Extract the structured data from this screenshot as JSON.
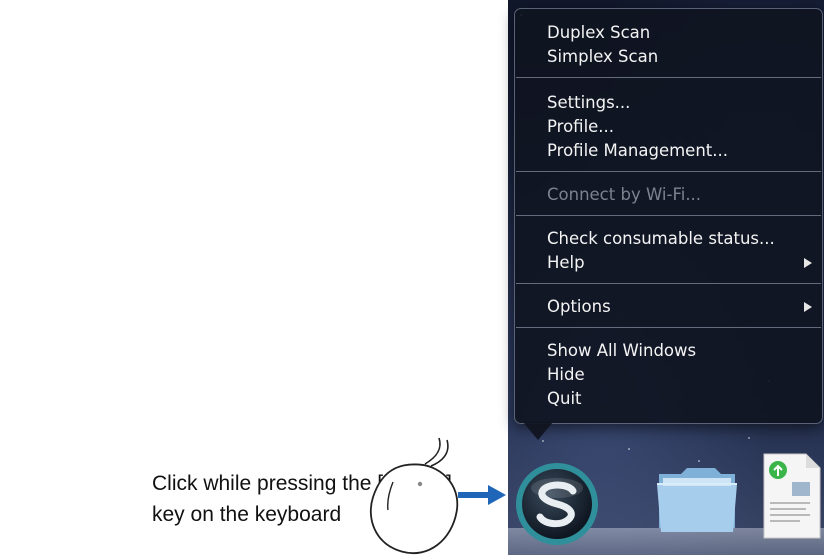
{
  "caption": {
    "line1": "Click while pressing the [control]",
    "line2": "key on the keyboard"
  },
  "menu": {
    "items": [
      {
        "label": "Duplex Scan",
        "enabled": true
      },
      {
        "label": "Simplex Scan",
        "enabled": true
      },
      {
        "label": "Settings...",
        "enabled": true
      },
      {
        "label": "Profile...",
        "enabled": true
      },
      {
        "label": "Profile Management...",
        "enabled": true
      },
      {
        "label": "Connect by Wi-Fi...",
        "enabled": false
      },
      {
        "label": "Check consumable status...",
        "enabled": true
      },
      {
        "label": "Help",
        "enabled": true,
        "submenu": true
      },
      {
        "label": "Options",
        "enabled": true,
        "submenu": true
      },
      {
        "label": "Show All Windows",
        "enabled": true
      },
      {
        "label": "Hide",
        "enabled": true
      },
      {
        "label": "Quit",
        "enabled": true
      }
    ]
  },
  "dock": {
    "icons": [
      "scansnap-manager-icon",
      "folder-icon",
      "document-icon"
    ]
  },
  "colors": {
    "menu_text": "#f4f4f4",
    "menu_disabled_text": "#7e828d",
    "arrow_blue": "#1f66b8",
    "scansnap_teal": "#2f8f9a"
  }
}
